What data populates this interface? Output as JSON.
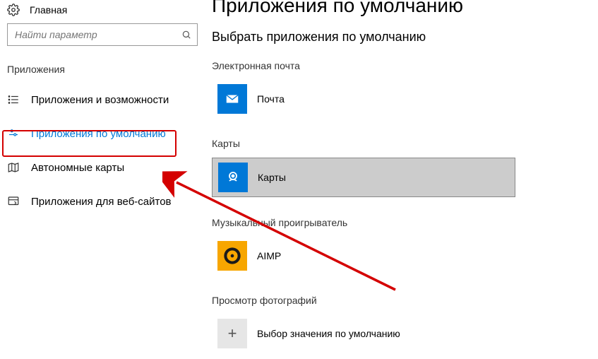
{
  "sidebar": {
    "home": "Главная",
    "searchPlaceholder": "Найти параметр",
    "section": "Приложения",
    "items": [
      {
        "label": "Приложения и возможности"
      },
      {
        "label": "Приложения по умолчанию"
      },
      {
        "label": "Автономные карты"
      },
      {
        "label": "Приложения для веб-сайтов"
      }
    ]
  },
  "main": {
    "title": "Приложения по умолчанию",
    "subtitle": "Выбрать приложения по умолчанию",
    "categories": [
      {
        "label": "Электронная почта",
        "app": "Почта"
      },
      {
        "label": "Карты",
        "app": "Карты"
      },
      {
        "label": "Музыкальный проигрыватель",
        "app": "AIMP"
      },
      {
        "label": "Просмотр фотографий",
        "app": "Выбор значения по умолчанию"
      }
    ]
  }
}
